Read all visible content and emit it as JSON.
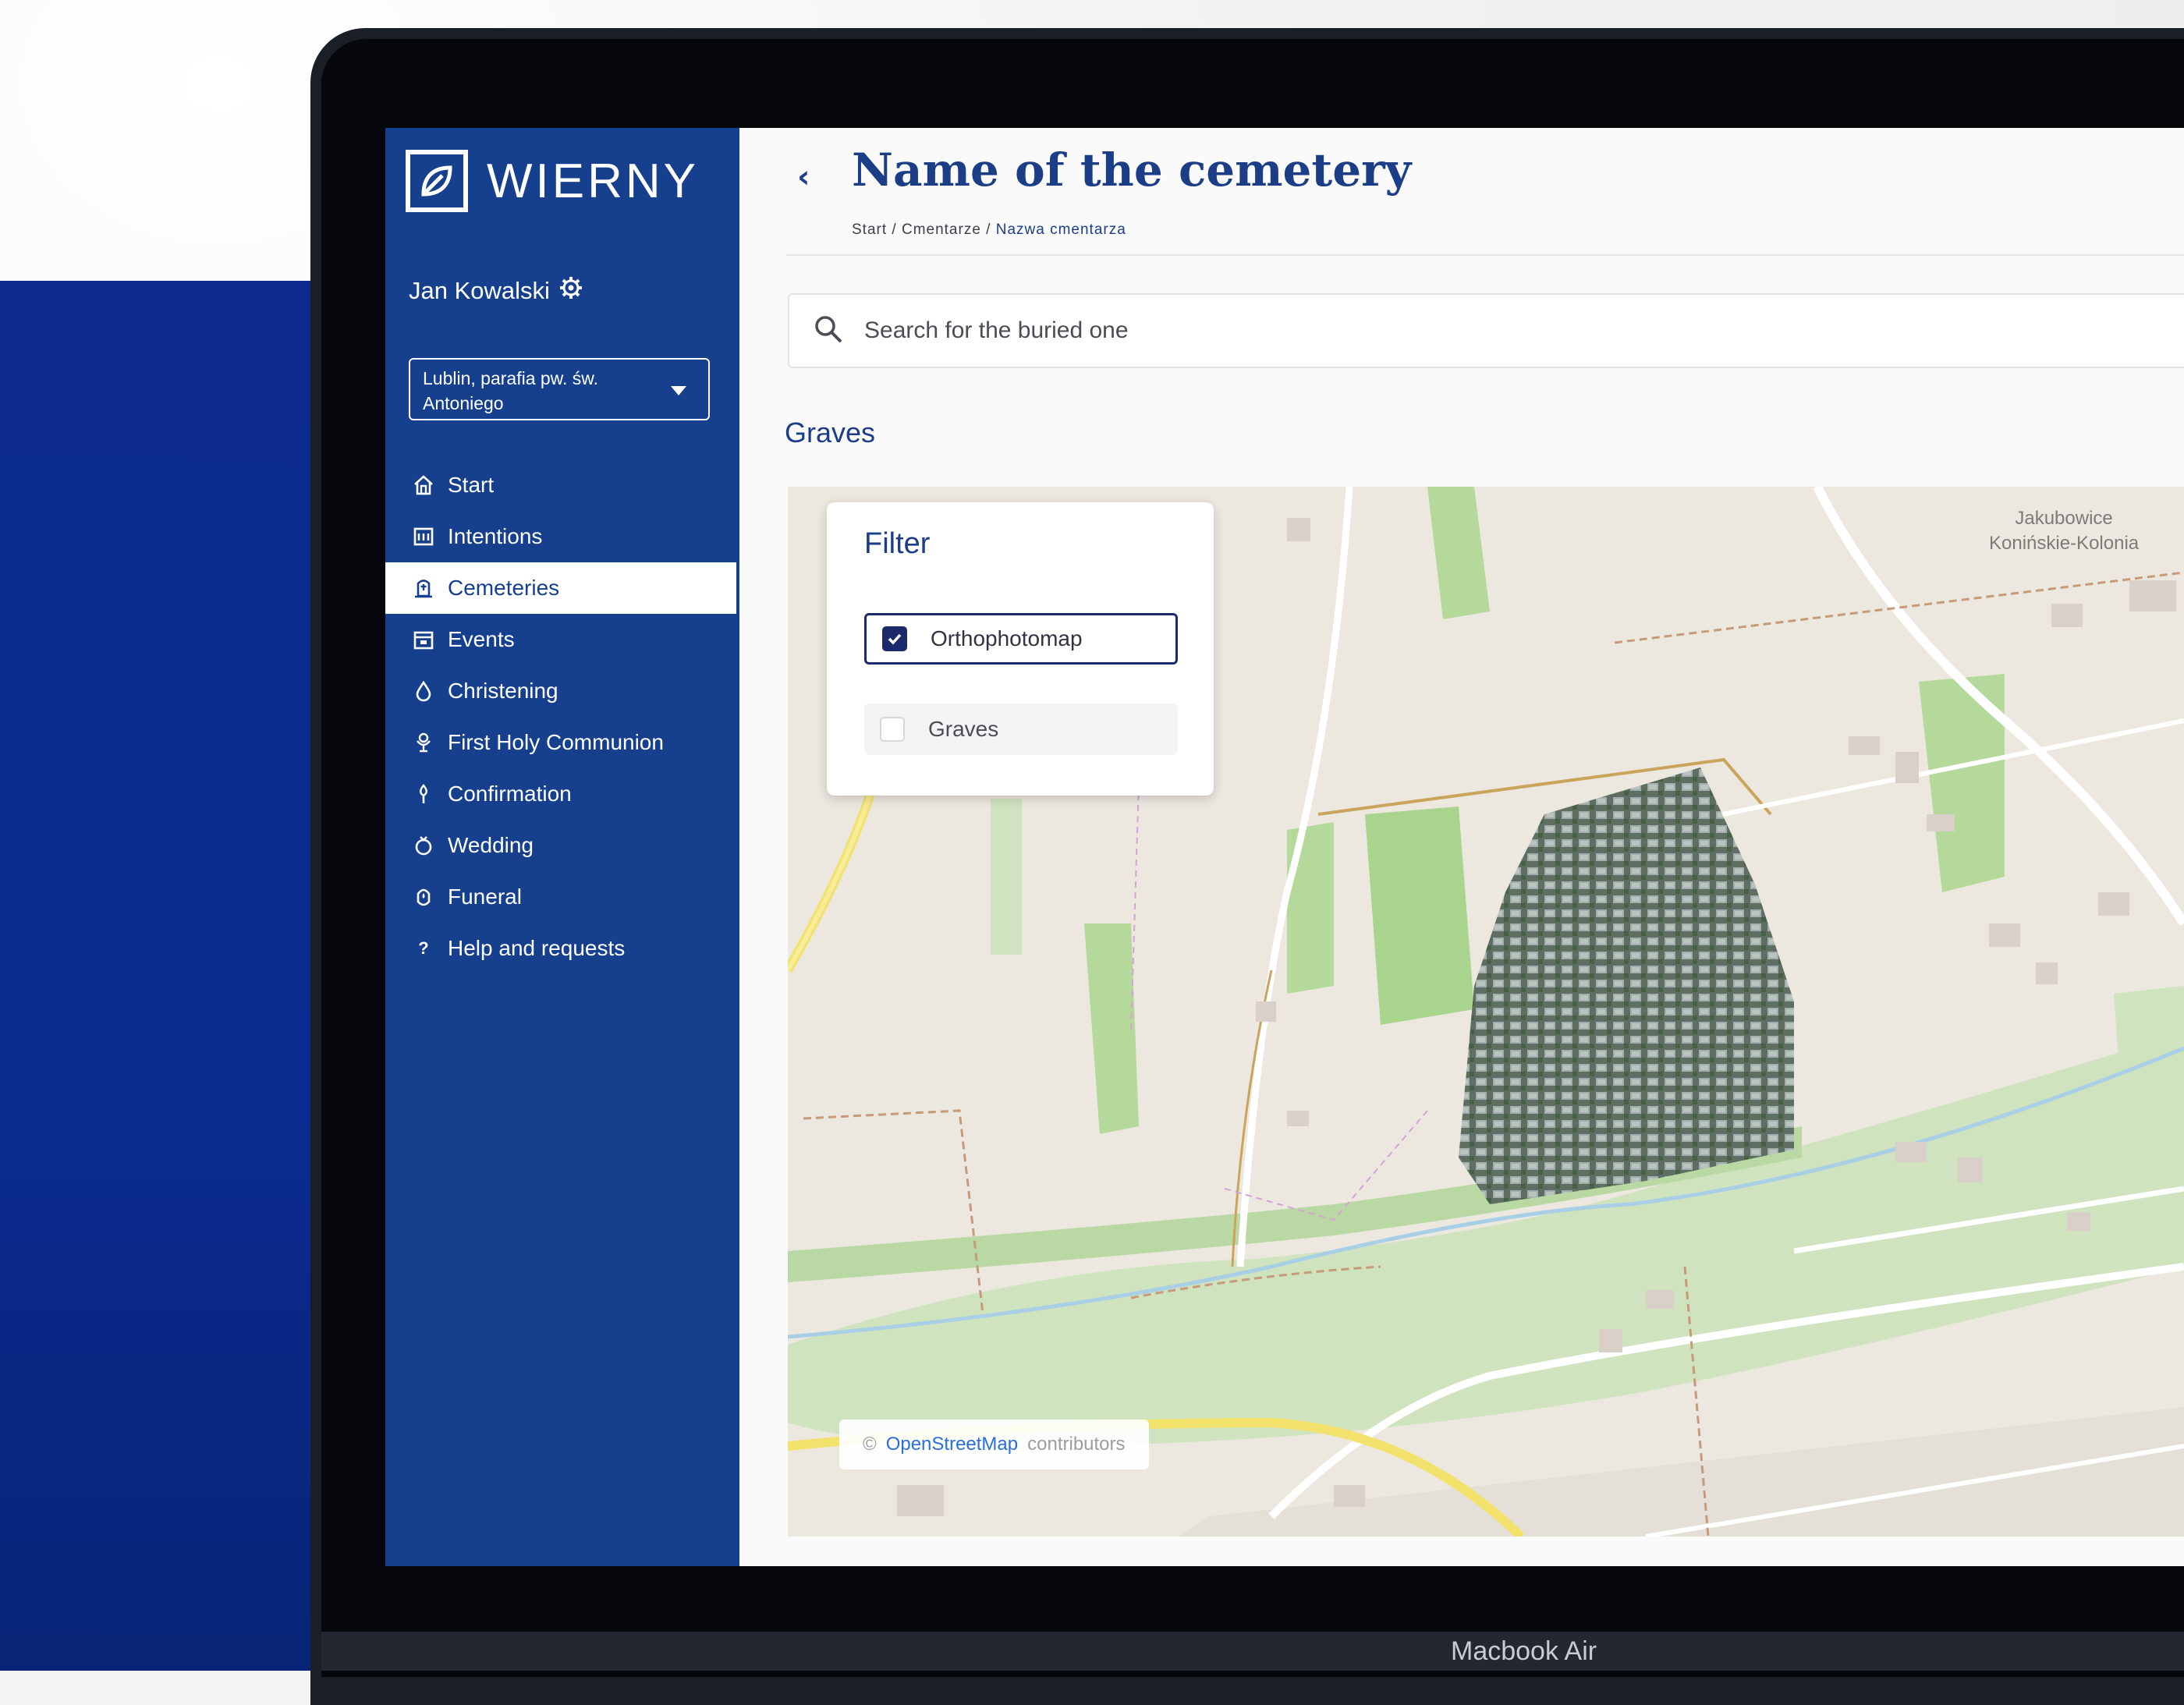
{
  "device": {
    "label": "Macbook Air"
  },
  "sidebar": {
    "logo_text": "WIERNY",
    "user_name": "Jan Kowalski",
    "parish_select": "Lublin, parafia pw. św. Antoniego",
    "items": [
      {
        "label": "Start",
        "icon": "home-icon"
      },
      {
        "label": "Intentions",
        "icon": "calendar-list-icon"
      },
      {
        "label": "Cemeteries",
        "icon": "tombstone-icon"
      },
      {
        "label": "Events",
        "icon": "event-icon"
      },
      {
        "label": "Christening",
        "icon": "drop-icon"
      },
      {
        "label": "First Holy Communion",
        "icon": "chalice-icon"
      },
      {
        "label": "Confirmation",
        "icon": "flame-icon"
      },
      {
        "label": "Wedding",
        "icon": "rings-icon"
      },
      {
        "label": "Funeral",
        "icon": "candle-icon"
      },
      {
        "label": "Help and requests",
        "icon": "question-icon"
      }
    ],
    "active_index": 2
  },
  "header": {
    "title": "Name of the cemetery",
    "breadcrumb": [
      "Start",
      "Cmentarze",
      "Nazwa cmentarza"
    ]
  },
  "search": {
    "placeholder": "Search for the buried one"
  },
  "section_title": "Graves",
  "filter": {
    "title": "Filter",
    "options": [
      {
        "label": "Orthophotomap",
        "checked": true
      },
      {
        "label": "Graves",
        "checked": false
      }
    ]
  },
  "map": {
    "place_label_1": "Jakubowice",
    "place_label_2": "Konińskie-Kolonia",
    "attribution_symbol": "©",
    "attribution_link": "OpenStreetMap",
    "attribution_text": "contributors"
  },
  "colors": {
    "sidebar": "#16408e",
    "accent": "#1b3e87",
    "checkbox": "#1b2a6b"
  }
}
